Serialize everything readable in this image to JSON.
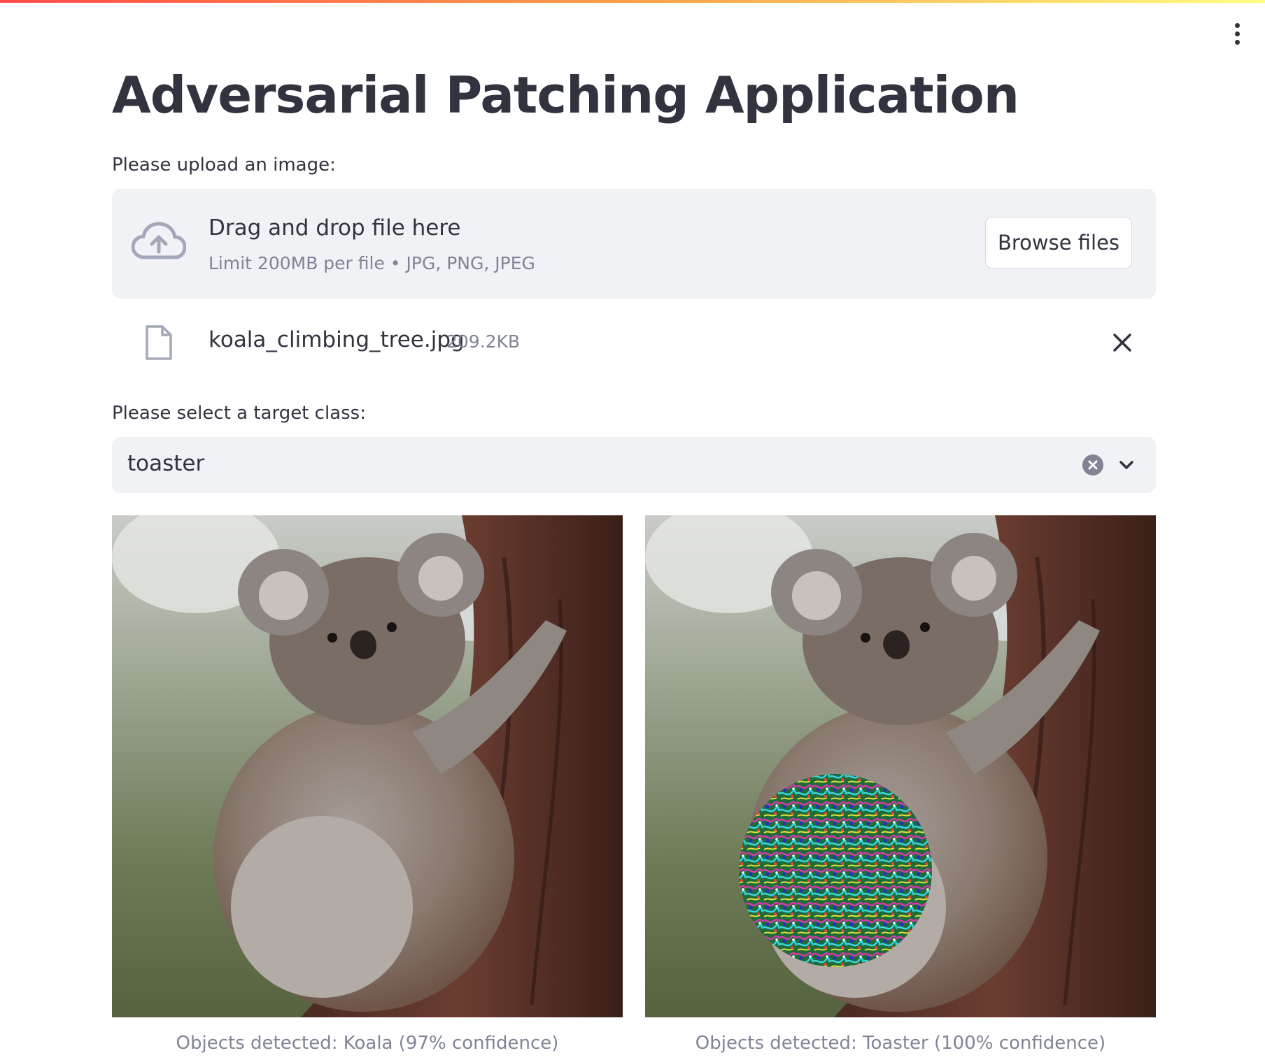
{
  "header": {
    "title": "Adversarial Patching Application"
  },
  "uploader": {
    "label": "Please upload an image:",
    "drop_title": "Drag and drop file here",
    "limit_text": "Limit 200MB per file • JPG, PNG, JPEG",
    "browse_label": "Browse files",
    "file": {
      "name": "koala_climbing_tree.jpg",
      "size": "209.2KB"
    }
  },
  "target_select": {
    "label": "Please select a target class:",
    "value": "toaster"
  },
  "images": [
    {
      "caption": "Objects detected: Koala (97% confidence)"
    },
    {
      "caption": "Objects detected: Toaster (100% confidence)"
    }
  ],
  "colors": {
    "text": "#31333f",
    "muted": "#808495",
    "panel": "#f0f2f6",
    "accent_gradient": [
      "#ff4b4b",
      "#ff9f48",
      "#fffd80"
    ]
  },
  "icons": {
    "menu": "three-dots-vertical-icon",
    "upload": "cloud-upload-icon",
    "file": "file-icon",
    "remove": "close-icon",
    "clear": "clear-circle-icon",
    "dropdown": "chevron-down-icon"
  }
}
